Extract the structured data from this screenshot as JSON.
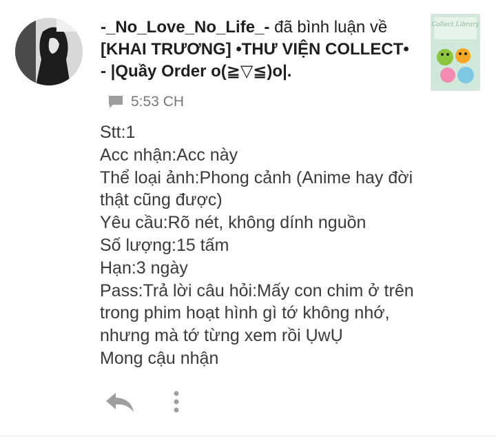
{
  "notification": {
    "username": "-_No_Love_No_Life_-",
    "action_text": "đã bình luận về",
    "post_title": "[KHAI TRƯƠNG] •THƯ VIỆN COLLECT• - |Quầy Order o(≧▽≦)o|.",
    "time": "5:53 CH",
    "thumbnail_text": "Collect Library"
  },
  "comment": {
    "lines": [
      "Stt:1",
      "Acc nhận:Acc này",
      "Thể loại ảnh:Phong cảnh (Anime hay đời thật cũng được)",
      "Yêu cầu:Rõ nét, không dính nguồn",
      "Số lượng:15 tấm",
      "Hạn:3 ngày",
      "Pass:Trả lời câu hỏi:Mấy con chim ở trên trong phim hoạt hình gì tớ không nhớ, nhưng mà tớ từng xem rồi ỤwỤ",
      "Mong cậu nhận"
    ]
  },
  "icons": {
    "comment": "comment-icon",
    "reply": "reply-icon",
    "more": "more-vertical-icon"
  },
  "colors": {
    "meta_text": "#777777",
    "body_text": "#3a3a3a",
    "icon_gray": "#9e9e9e"
  }
}
